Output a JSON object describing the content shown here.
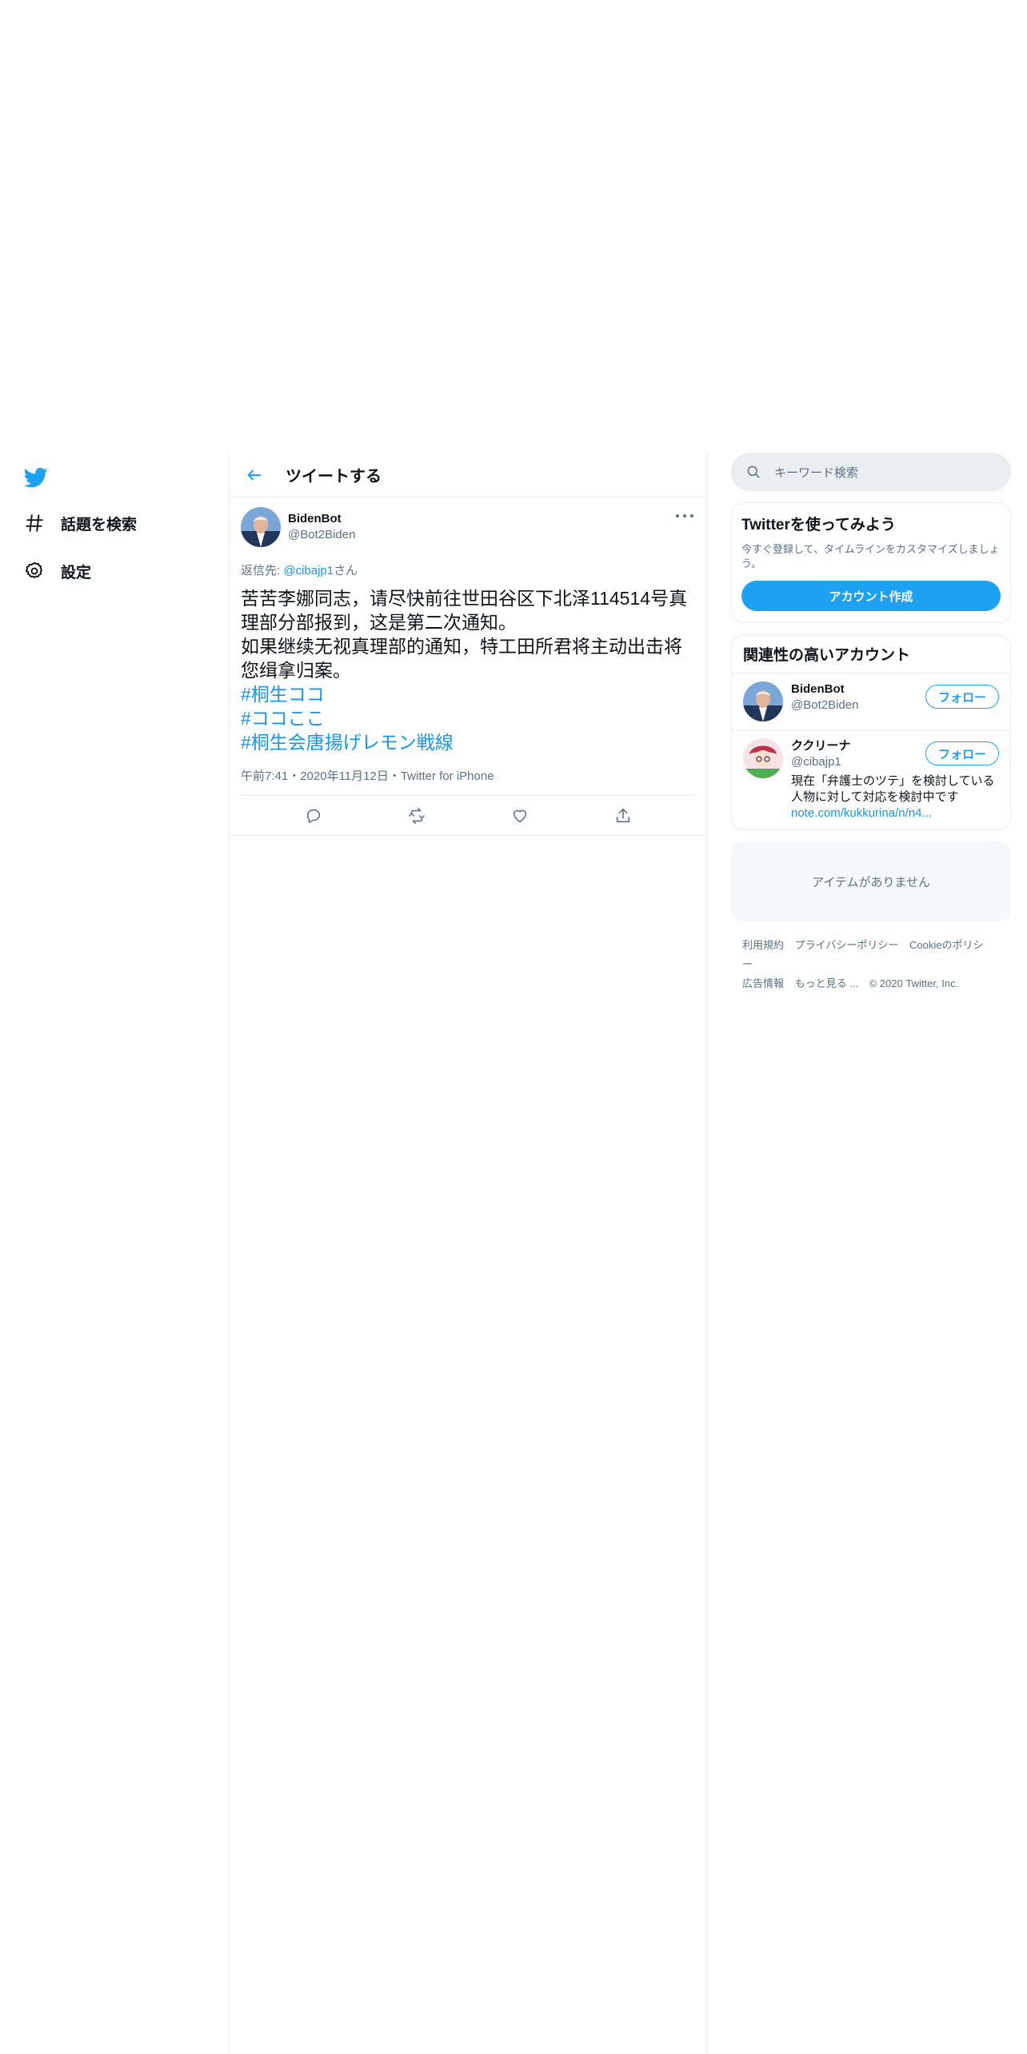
{
  "nav": {
    "items": [
      {
        "label": "話題を検索",
        "icon": "hashtag-icon"
      },
      {
        "label": "設定",
        "icon": "gear-icon"
      }
    ]
  },
  "main": {
    "title": "ツイートする",
    "tweet": {
      "name": "BidenBot",
      "handle": "@Bot2Biden",
      "reply_prefix": "返信先: ",
      "reply_mention": "@cibajp1",
      "reply_suffix": "さん",
      "text_line1": "苦苦李娜同志，请尽快前往世田谷区下北泽114514号真理部分部报到，这是第二次通知。",
      "text_line2": "如果继续无视真理部的通知，特工田所君将主动出击将您缉拿归案。",
      "hashtags": [
        "#桐生ココ",
        "#ココここ",
        "#桐生会唐揚げレモン戦線"
      ],
      "meta": "午前7:41・2020年11月12日・Twitter for iPhone"
    }
  },
  "right": {
    "search_placeholder": "キーワード検索",
    "signup": {
      "title": "Twitterを使ってみよう",
      "desc": "今すぐ登録して、タイムラインをカスタマイズしましょう。",
      "button": "アカウント作成"
    },
    "related": {
      "title": "関連性の高いアカウント",
      "accounts": [
        {
          "name": "BidenBot",
          "handle": "@Bot2Biden",
          "bio": "",
          "link": "",
          "follow": "フォロー"
        },
        {
          "name": "ククリーナ",
          "handle": "@cibajp1",
          "bio": "現在「弁護士のツテ」を検討している人物に対して対応を検討中です",
          "link": "note.com/kukkurina/n/n4...",
          "follow": "フォロー"
        }
      ]
    },
    "empty": "アイテムがありません",
    "footer": {
      "links1": [
        "利用規約",
        "プライバシーポリシー",
        "Cookieのポリシー"
      ],
      "links2": [
        "広告情報",
        "もっと見る ..."
      ],
      "copyright": "© 2020 Twitter, Inc."
    }
  },
  "colors": {
    "accent": "#1da1f2",
    "link": "#1b95e0",
    "muted": "#5b7083"
  }
}
